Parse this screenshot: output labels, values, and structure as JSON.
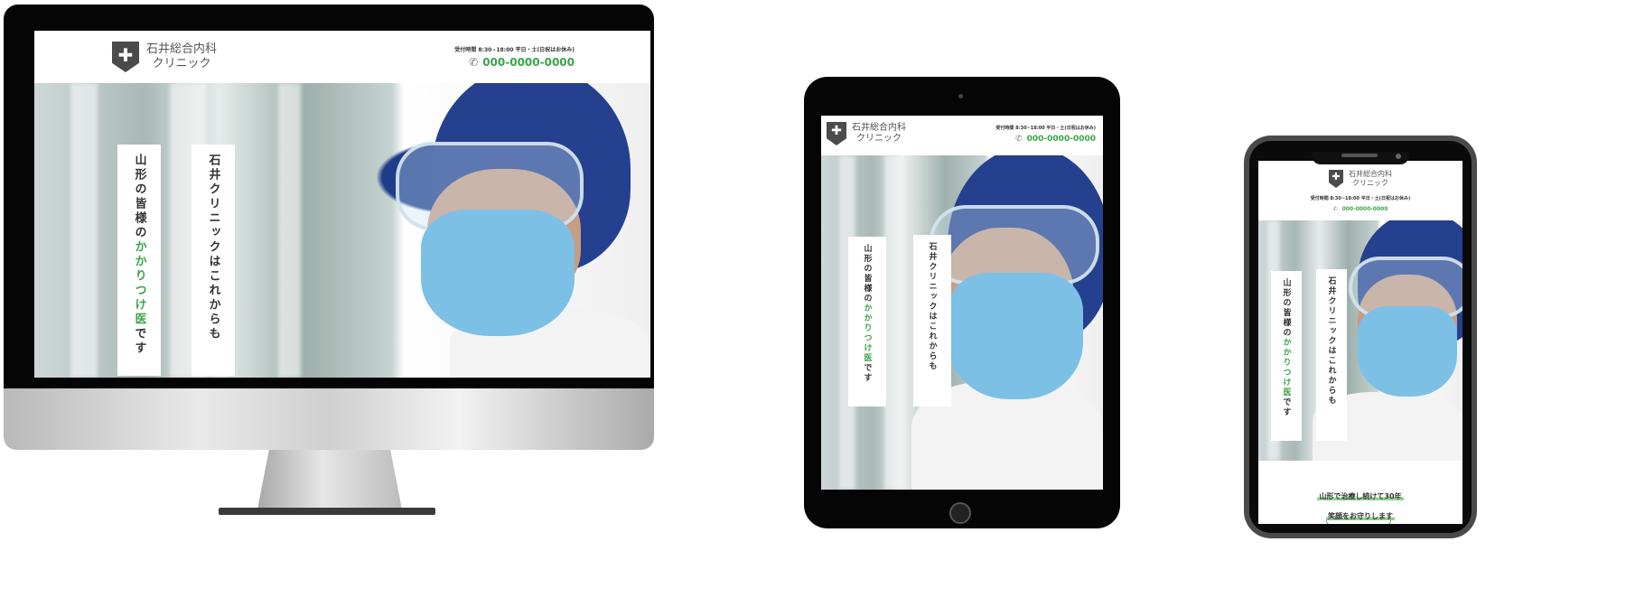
{
  "site": {
    "logo_line1": "石井総合内科",
    "logo_line2": "クリニック",
    "cross": "✚",
    "hours": "受付時間 8:30~18:00 平日・土(日祝はお休み)",
    "phone": "000-0000-0000",
    "phone_icon": "phone-icon",
    "hero_left_prefix": "山形の皆様の",
    "hero_left_green": "かかりつけ医",
    "hero_left_suffix": "です",
    "hero_right": "石井クリニックはこれからも",
    "mobile_tag1": "山形で治療し続けて30年",
    "mobile_tag2": "笑顔をお守りします"
  },
  "colors": {
    "accent": "#3aa548",
    "shield": "#4b4b4b",
    "device": "#050505"
  }
}
